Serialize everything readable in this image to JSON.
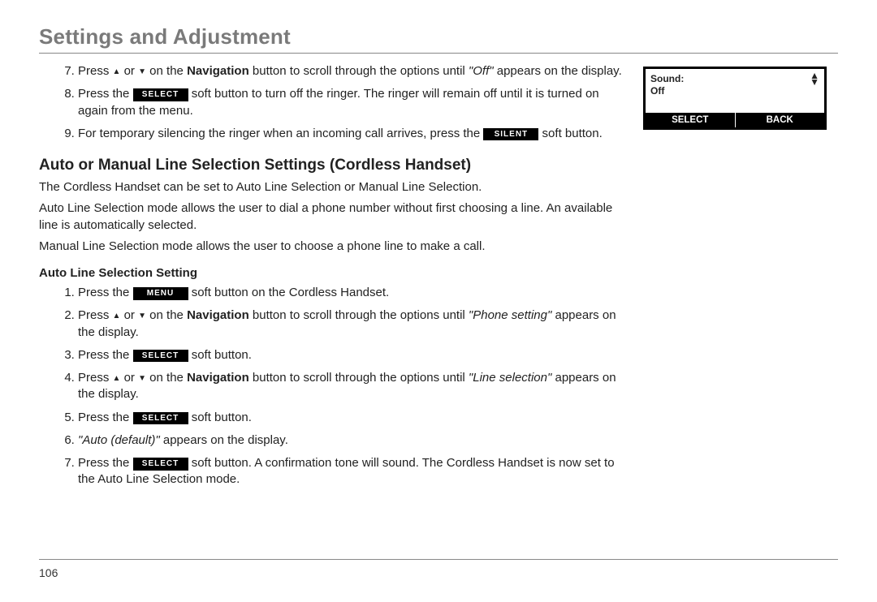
{
  "page": {
    "title": "Settings and Adjustment",
    "number": "106"
  },
  "keys": {
    "select": "SELECT",
    "silent": "SILENT",
    "menu": "MENU"
  },
  "phone_display": {
    "line1_label": "Sound:",
    "line2_value": "Off",
    "footer_left": "SELECT",
    "footer_right": "BACK"
  },
  "top_steps": {
    "s7a": "Press ",
    "s7b": " or ",
    "s7c": " on the ",
    "s7nav": "Navigation",
    "s7d": " button to scroll through the options until ",
    "s7off": "\"Off\"",
    "s7e": " appears on the display.",
    "s8a": "Press the ",
    "s8b": " soft button to turn off the ringer. The ringer will remain off until it is turned on again from the menu.",
    "s9a": "For temporary silencing the ringer when an incoming call arrives, press the ",
    "s9b": " soft button."
  },
  "section": {
    "heading": "Auto or Manual Line Selection Settings (Cordless Handset)",
    "p1": "The Cordless Handset can be set to Auto Line Selection or Manual Line Selection.",
    "p2": "Auto Line Selection mode allows the user to dial a phone number without first choosing a line. An available line is automatically selected.",
    "p3": "Manual Line Selection mode allows the user to choose a phone line to make a call.",
    "sub_heading": "Auto Line Selection Setting"
  },
  "auto_steps": {
    "s1a": "Press the ",
    "s1b": " soft button on the Cordless Handset.",
    "s2a": "Press ",
    "s2b": " or ",
    "s2c": " on the ",
    "s2nav": "Navigation",
    "s2d": " button to scroll through the options until ",
    "s2ps": "\"Phone setting\"",
    "s2e": " appears on the display.",
    "s3a": "Press the ",
    "s3b": " soft button.",
    "s4a": "Press ",
    "s4b": " or ",
    "s4c": " on the ",
    "s4nav": "Navigation",
    "s4d": " button to scroll through the options until ",
    "s4ls": "\"Line selection\"",
    "s4e": " appears on the display.",
    "s5a": "Press the ",
    "s5b": " soft button.",
    "s6a": "\"Auto (default)\"",
    "s6b": " appears on the display.",
    "s7a": "Press the ",
    "s7b": " soft button. A confirmation tone will sound. The Cordless Handset is now set to the Auto Line Selection mode."
  }
}
